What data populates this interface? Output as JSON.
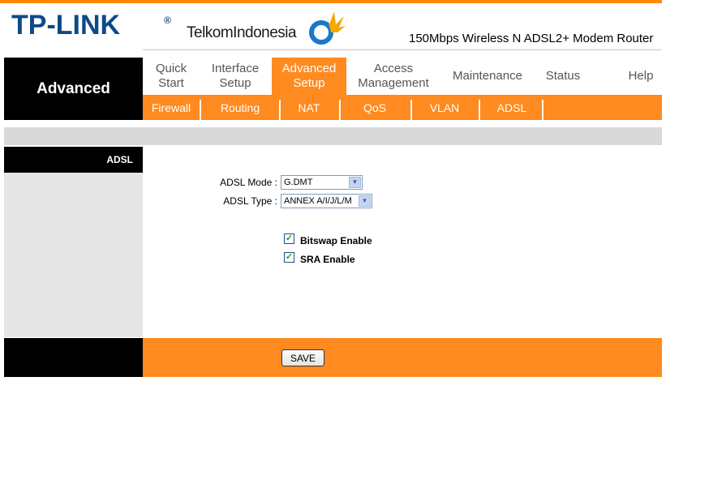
{
  "header": {
    "brand": "TP-LINK",
    "brand_mark": "®",
    "isp": "TelkomIndonesia",
    "model": "150Mbps Wireless N ADSL2+ Modem Router"
  },
  "section_title": "Advanced",
  "nav": [
    {
      "label": "Quick\nStart"
    },
    {
      "label": "Interface\nSetup"
    },
    {
      "label": "Advanced\nSetup",
      "active": true
    },
    {
      "label": "Access\nManagement"
    },
    {
      "label": "Maintenance"
    },
    {
      "label": "Status"
    },
    {
      "label": "Help"
    }
  ],
  "subnav": [
    {
      "label": "Firewall"
    },
    {
      "label": "Routing"
    },
    {
      "label": "NAT"
    },
    {
      "label": "QoS"
    },
    {
      "label": "VLAN"
    },
    {
      "label": "ADSL",
      "active": true
    }
  ],
  "sidebar": {
    "title": "ADSL"
  },
  "form": {
    "adsl_mode_label": "ADSL Mode :",
    "adsl_mode_value": "G.DMT",
    "adsl_type_label": "ADSL Type :",
    "adsl_type_value": "ANNEX A/I/J/L/M",
    "bitswap_label": "Bitswap Enable",
    "bitswap_checked": true,
    "sra_label": "SRA Enable",
    "sra_checked": true
  },
  "footer": {
    "save_label": "SAVE"
  },
  "colors": {
    "accent": "#ff8a1f",
    "brand_blue": "#0d4a88"
  }
}
